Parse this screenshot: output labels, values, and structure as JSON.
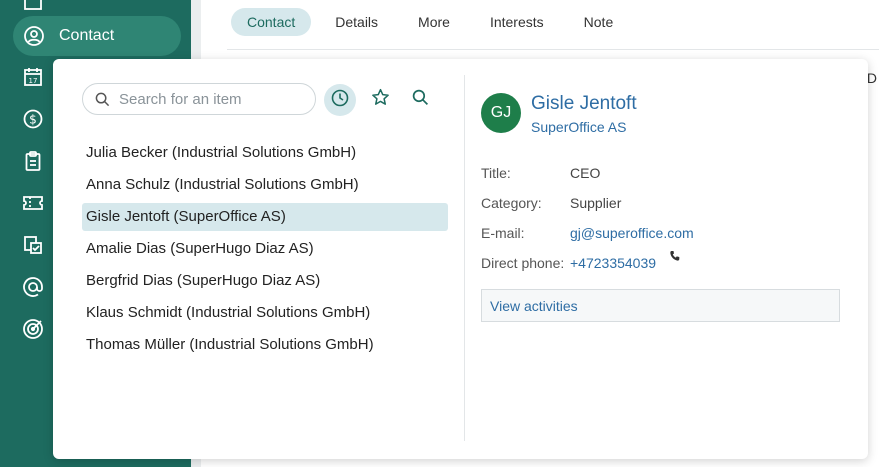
{
  "sidebar": {
    "partial_label": "",
    "active_label": "Contact",
    "icons": [
      "building-icon",
      "contact-icon",
      "calendar-icon",
      "dollar-icon",
      "clipboard-icon",
      "ticket-icon",
      "documents-icon",
      "mail-at-icon",
      "target-icon"
    ]
  },
  "tabs": [
    "Contact",
    "Details",
    "More",
    "Interests",
    "Note"
  ],
  "peek_text": "D",
  "search": {
    "placeholder": "Search for an item"
  },
  "recent_items": [
    "Julia Becker (Industrial Solutions GmbH)",
    "Anna Schulz (Industrial Solutions GmbH)",
    "Gisle Jentoft (SuperOffice AS)",
    "Amalie Dias (SuperHugo Diaz AS)",
    "Bergfrid Dias (SuperHugo Diaz AS)",
    "Klaus Schmidt (Industrial Solutions GmbH)",
    "Thomas Müller (Industrial Solutions GmbH)"
  ],
  "selected_index": 2,
  "contact": {
    "initials": "GJ",
    "name": "Gisle Jentoft",
    "company": "SuperOffice AS",
    "title_label": "Title:",
    "title_value": "CEO",
    "category_label": "Category:",
    "category_value": "Supplier",
    "email_label": "E-mail:",
    "email_value": "gj@superoffice.com",
    "phone_label": "Direct phone:",
    "phone_value": "+4723354039",
    "view_activities": "View activities"
  },
  "colors": {
    "sidebar": "#1d6b5f",
    "sidebar_active": "#2f8574",
    "accent": "#1d6b5f",
    "link": "#2e6da4",
    "selected_bg": "#d6e8ec",
    "avatar": "#1e7e4a"
  }
}
